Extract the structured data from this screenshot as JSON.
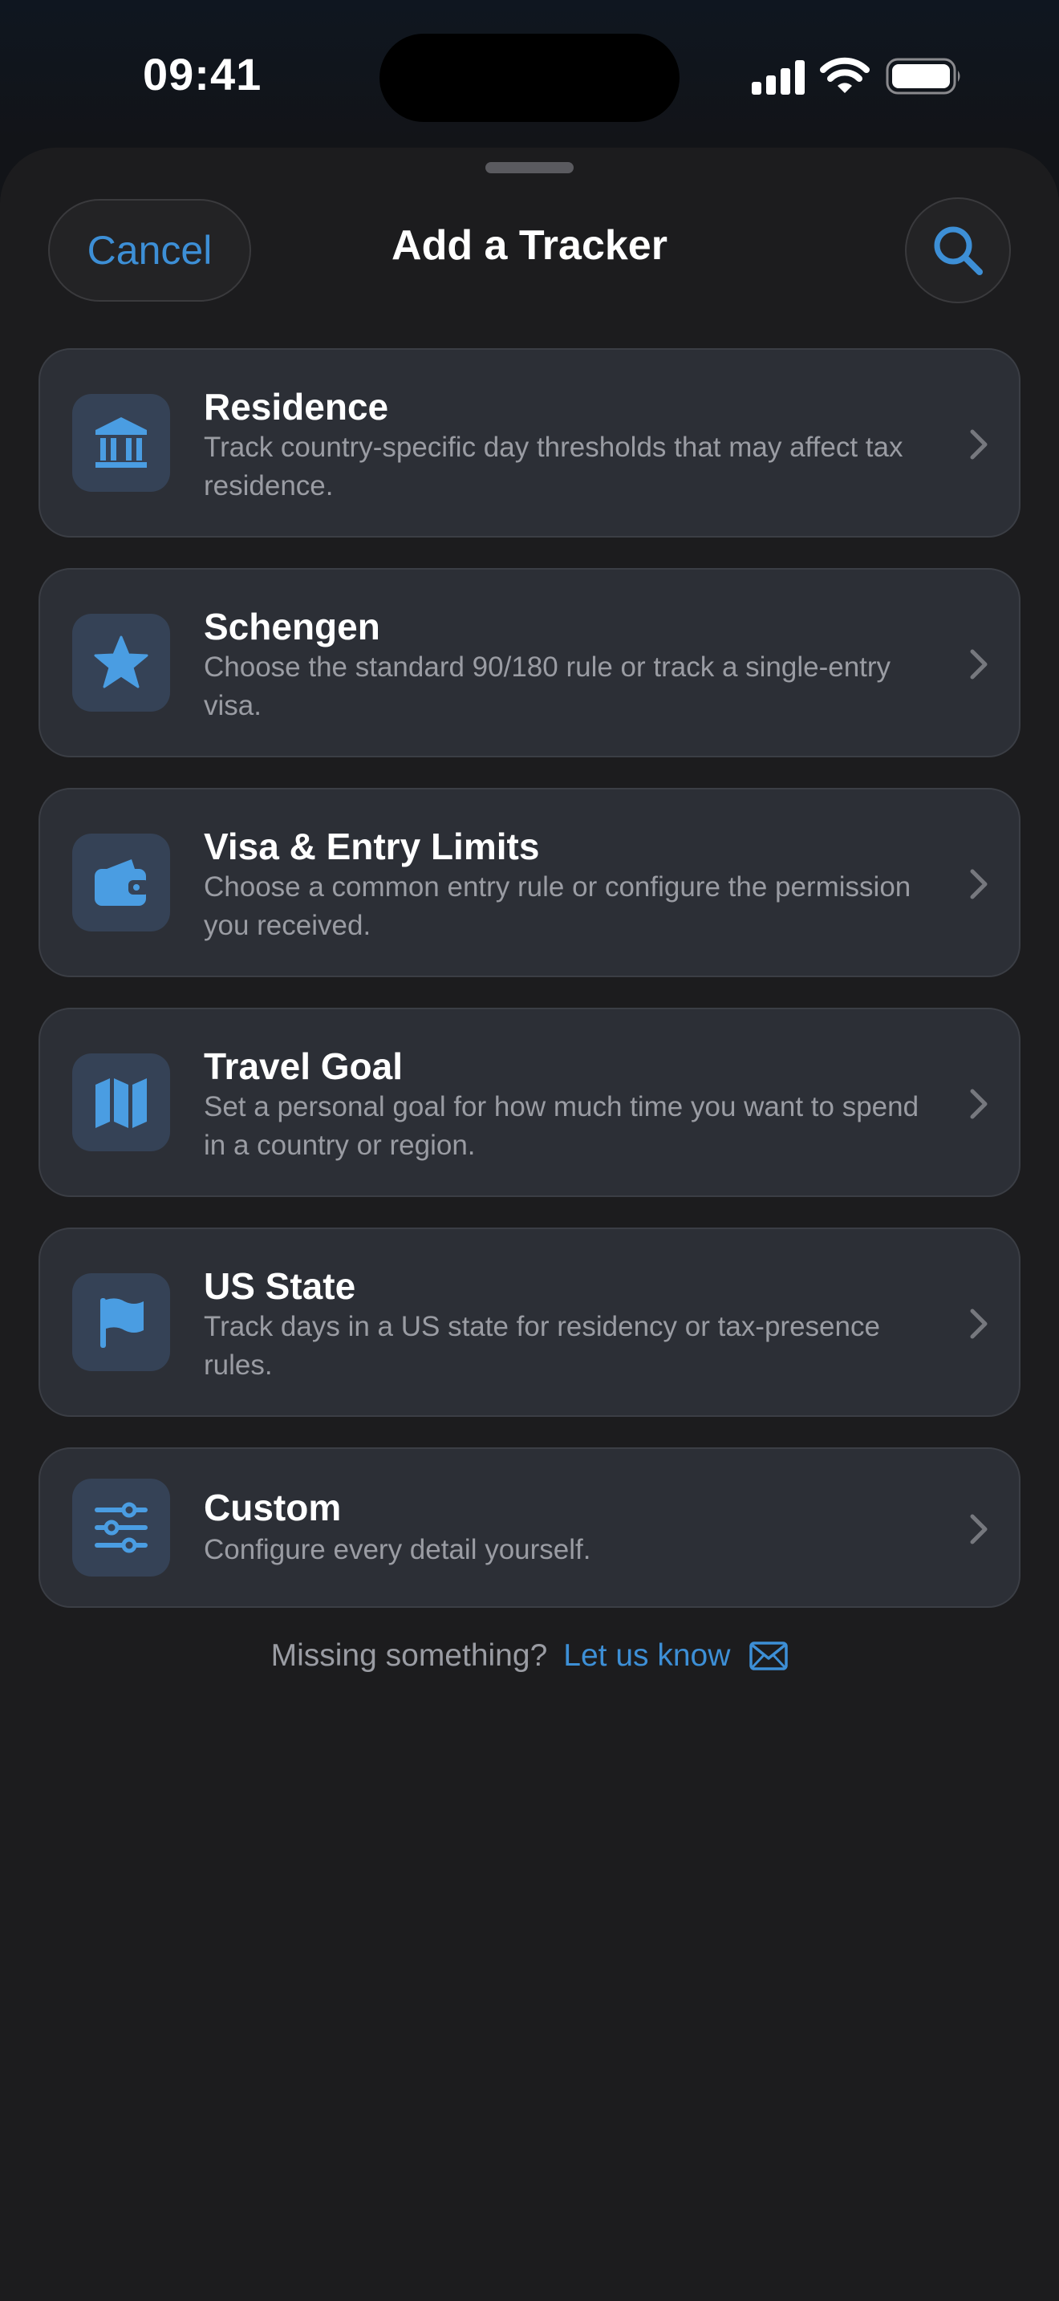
{
  "status_bar": {
    "time": "09:41"
  },
  "header": {
    "cancel_label": "Cancel",
    "title": "Add a Tracker",
    "search_icon": "search-icon"
  },
  "trackers": [
    {
      "title": "Residence",
      "description": "Track country-specific day thresholds that may affect tax residence.",
      "icon": "bank-icon"
    },
    {
      "title": "Schengen",
      "description": "Choose the standard 90/180 rule or track a single-entry visa.",
      "icon": "star-icon"
    },
    {
      "title": "Visa & Entry Limits",
      "description": "Choose a common entry rule or configure the permission you received.",
      "icon": "wallet-icon"
    },
    {
      "title": "Travel Goal",
      "description": "Set a personal goal for how much time you want to spend in a country or region.",
      "icon": "map-icon"
    },
    {
      "title": "US State",
      "description": "Track days in a US state for residency or tax-presence rules.",
      "icon": "flag-icon"
    },
    {
      "title": "Custom",
      "description": "Configure every detail yourself.",
      "icon": "sliders-icon"
    }
  ],
  "footer": {
    "text": "Missing something?",
    "link_label": "Let us know",
    "icon": "envelope-icon"
  },
  "colors": {
    "accent": "#3d8fd6",
    "card_background": "#2c2f36",
    "sheet_background": "#1c1c1e",
    "secondary_text": "#9a9ca3"
  }
}
